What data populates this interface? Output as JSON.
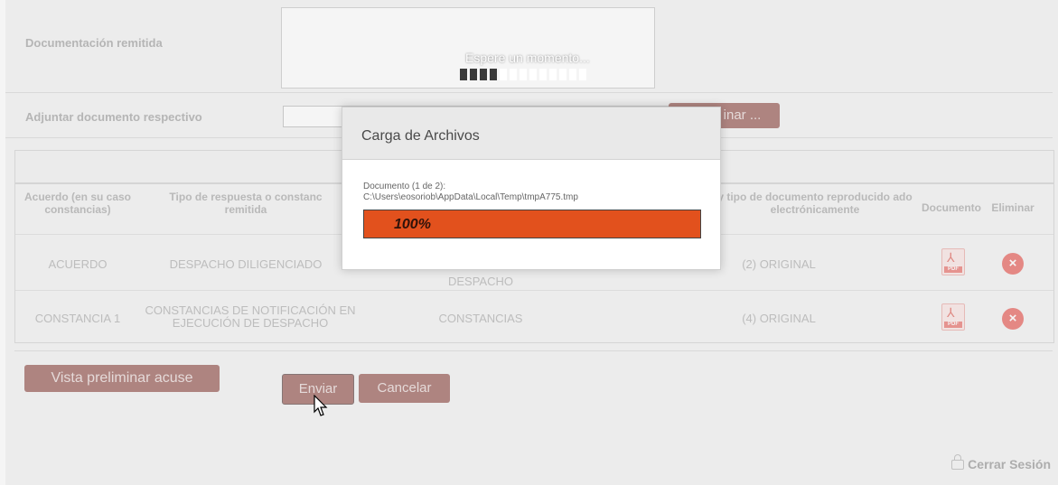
{
  "form": {
    "documentacion_label": "Documentación remitida",
    "adjuntar_label": "Adjuntar documento respectivo",
    "examinar_label": "inar ..."
  },
  "table": {
    "headers": {
      "acuerdo": "Acuerdo (en su caso constancias)",
      "tipo_respuesta": "Tipo de respuesta o constanc remitida",
      "tipo_documento": "y tipo de documento reproducido ado electrónicamente",
      "documento": "Documento",
      "eliminar": "Eliminar"
    },
    "rows": [
      {
        "acuerdo": "ACUERDO",
        "tipo_respuesta": "DESPACHO DILIGENCIADO",
        "tipo": "DESPACHO",
        "documento_tipo": "(2) ORIGINAL"
      },
      {
        "acuerdo": "CONSTANCIA 1",
        "tipo_respuesta": "CONSTANCIAS DE NOTIFICACIÓN EN EJECUCIÓN DE DESPACHO",
        "tipo": "CONSTANCIAS",
        "documento_tipo": "(4) ORIGINAL"
      }
    ],
    "pdf_tag": "PDF"
  },
  "actions": {
    "vista_preliminar": "Vista preliminar acuse",
    "enviar": "Enviar",
    "cancelar": "Cancelar"
  },
  "session": {
    "logout_label": "Cerrar Sesión"
  },
  "loading": {
    "text": "Espere un momento...",
    "bars_dark": 4,
    "bars_total": 13
  },
  "modal": {
    "title": "Carga de Archivos",
    "doc_counter": "Documento (1 de 2):",
    "doc_path": "C:\\Users\\eosoriob\\AppData\\Local\\Temp\\tmpA775.tmp",
    "progress_pct": 100,
    "progress_label": "100%"
  },
  "colors": {
    "accent_button": "#b68a86",
    "progress": "#e2511d",
    "delete": "#ee8e8a"
  },
  "icons": {
    "pdf": "pdf-icon",
    "delete": "delete-icon",
    "lock": "lock-icon",
    "cursor": "mouse-cursor-icon"
  }
}
